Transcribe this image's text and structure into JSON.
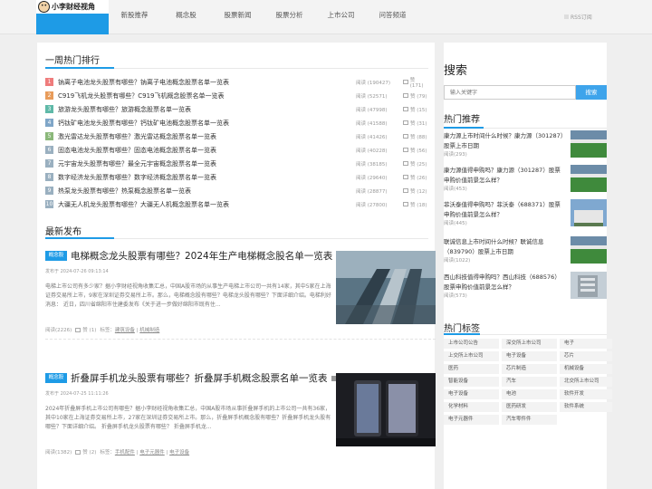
{
  "header": {
    "logo_text": "小李财经视角",
    "nav": [
      "新股推荐",
      "概念股",
      "股票新闻",
      "股票分析",
      "上市公司",
      "问答频道"
    ],
    "rss": "RSS订阅"
  },
  "hot": {
    "title": "一周热门排行",
    "views_label": "阅读",
    "items": [
      {
        "num": "1",
        "color": "#ef7c7c",
        "title": "钠离子电池龙头股票有哪些？钠离子电池概念股票名单一览表",
        "views": "(190427)",
        "likes": "赞 (171)"
      },
      {
        "num": "2",
        "color": "#e89c5b",
        "title": "C919飞机龙头股票有哪些？C919飞机概念股票名单一览表",
        "views": "(52571)",
        "likes": "赞 (79)"
      },
      {
        "num": "3",
        "color": "#5fb9a8",
        "title": "旅游龙头股票有哪些？旅游概念股票名单一览表",
        "views": "(47998)",
        "likes": "赞 (15)"
      },
      {
        "num": "4",
        "color": "#7fa6c8",
        "title": "钙钛矿电池龙头股票有哪些？钙钛矿电池概念股票名单一览表",
        "views": "(41588)",
        "likes": "赞 (31)"
      },
      {
        "num": "5",
        "color": "#8bb87a",
        "title": "激光雷达龙头股票有哪些？激光雷达概念股票名单一览表",
        "views": "(41426)",
        "likes": "赞 (88)"
      },
      {
        "num": "6",
        "color": "#9ab0c0",
        "title": "固态电池龙头股票有哪些？固态电池概念股票名单一览表",
        "views": "(40228)",
        "likes": "赞 (56)"
      },
      {
        "num": "7",
        "color": "#9ab0c0",
        "title": "元宇宙龙头股票有哪些？最全元宇宙概念股票名单一览表",
        "views": "(38185)",
        "likes": "赞 (25)"
      },
      {
        "num": "8",
        "color": "#9ab0c0",
        "title": "数字经济龙头股票有哪些？数字经济概念股票名单一览表",
        "views": "(29640)",
        "likes": "赞 (26)"
      },
      {
        "num": "9",
        "color": "#9ab0c0",
        "title": "热泵龙头股票有哪些？热泵概念股票名单一览表",
        "views": "(28877)",
        "likes": "赞 (12)"
      },
      {
        "num": "10",
        "color": "#9ab0c0",
        "title": "大疆无人机龙头股票有哪些？大疆无人机概念股票名单一览表",
        "views": "(27800)",
        "likes": "赞 (18)"
      }
    ]
  },
  "latest": {
    "title": "最新发布",
    "posts": [
      {
        "tag": "概念股",
        "title": "电梯概念龙头股票有哪些？2024年生产电梯概念股名单一览表",
        "meta": "发布于 2024-07-26 09:13:14",
        "excerpt": "电梯上市公司有多少家？据小李财经视角收集汇总，中国A股市场的从事生产电梯上市公司一共有14家，其中5家在上海证券交易所上市，9家在深圳证券交易所上市。那么，电梯概念股有哪些？电梯龙头股有哪些？下面详细介绍。电梯利好消息：  近日，四川省绵阳市住建委发布《关于进一步做好绵阳市既有住...",
        "views": "阅读(2226)",
        "likes": "赞 (1)",
        "tags_label": "标签：",
        "tags": [
          "建筑设备",
          "机械制造"
        ]
      },
      {
        "tag": "概念股",
        "title": "折叠屏手机龙头股票有哪些？折叠屏手机概念股票名单一览表",
        "meta": "发布于 2024-07-25 11:11:26",
        "excerpt": "2024年折叠屏手机上市公司有哪些？据小李财经视角收集汇总，中国A股市场从事折叠屏手机的上市公司一共有36家，其中10家在上海证券交易所上市，27家在深圳证券交易所上市。那么，折叠屏手机概念股有哪些？折叠屏手机龙头股有哪些？下面详细介绍。  折叠屏手机龙头股票有哪些？ 折叠屏手机龙...",
        "views": "阅读(1382)",
        "likes": "赞 (2)",
        "tags_label": "标签：",
        "tags": [
          "手机配件",
          "电子元器件",
          "电子设备"
        ]
      }
    ]
  },
  "search": {
    "title": "搜索",
    "placeholder": "输入关键字",
    "button": "搜索"
  },
  "recommend": {
    "title": "热门推荐",
    "items": [
      {
        "title": "康力源上市时间什么时候？康力源（301287）股票上市日期",
        "views": "阅读(293)",
        "img": "field"
      },
      {
        "title": "康力源值得申购吗？康力源（301287）股票申购价值前景怎么样？",
        "views": "阅读(453)",
        "img": "field"
      },
      {
        "title": "菲沃泰值得申购吗？菲沃泰（688371）股票申购价值前景怎么样？",
        "views": "阅读(445)",
        "img": "building"
      },
      {
        "title": "联诚信息上市时间什么时候？联诚信息（839790）股票上市日期",
        "views": "阅读(1022)",
        "img": "field"
      },
      {
        "title": "西山科技值得申购吗？西山科技（688576）股票申购价值前景怎么样？",
        "views": "阅读(573)",
        "img": "office"
      }
    ]
  },
  "tags": {
    "title": "热门标签",
    "items": [
      "上市公司公告",
      "深交所上市公司",
      "电子",
      "上交所上市公司",
      "电子设备",
      "芯片",
      "医药",
      "芯片制造",
      "机械设备",
      "智能设备",
      "汽车",
      "北交所上市公司",
      "电子设备",
      "电池",
      "软件开发",
      "化学材料",
      "医药研发",
      "软件系统",
      "电子元器件",
      "汽车零件件"
    ]
  }
}
